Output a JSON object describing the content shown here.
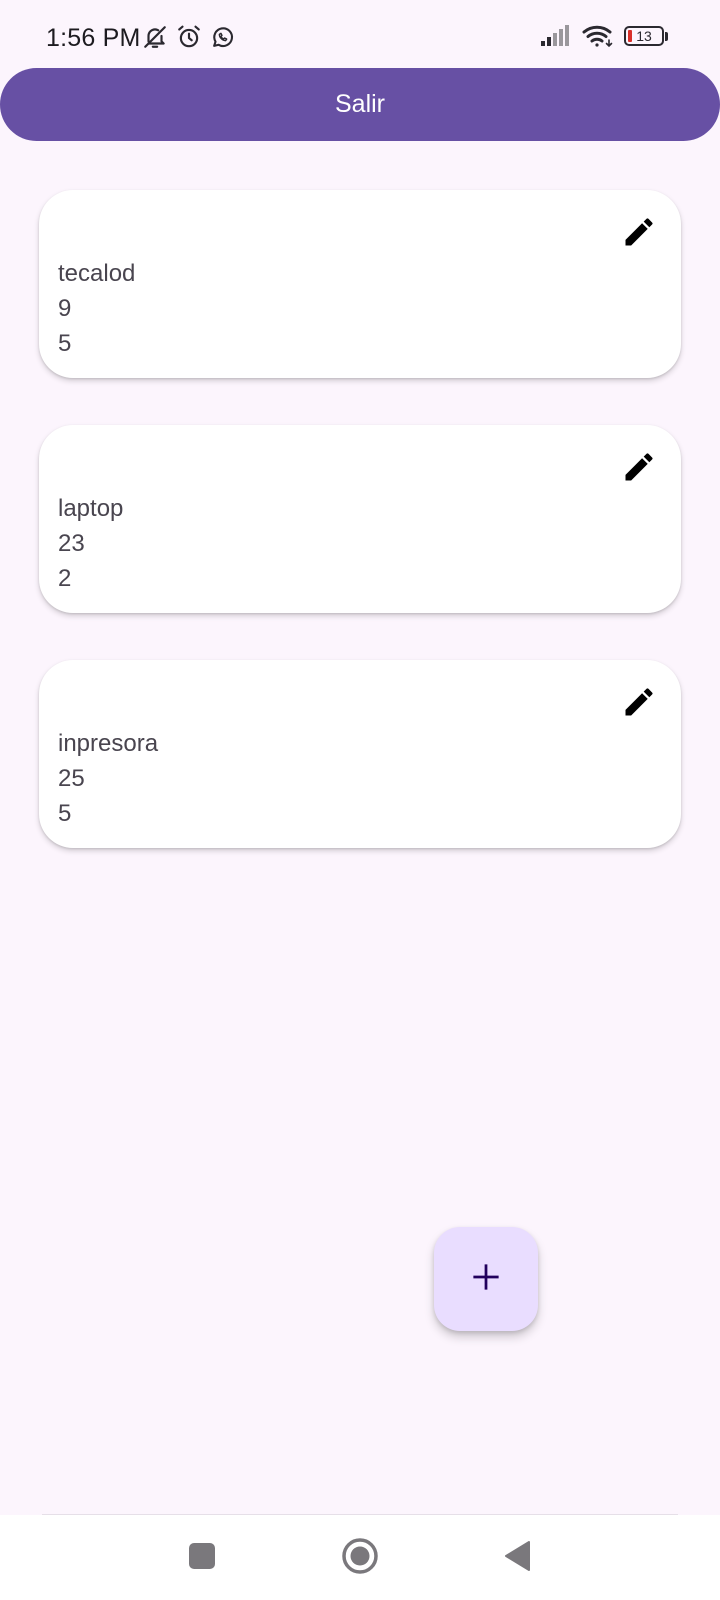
{
  "status_bar": {
    "time": "1:56 PM",
    "battery_level": "13",
    "icons_left": [
      "bell-off-icon",
      "alarm-icon",
      "whatsapp-icon"
    ],
    "icons_right": [
      "signal-icon",
      "wifi-icon",
      "battery-icon"
    ]
  },
  "header": {
    "exit_label": "Salir"
  },
  "items": [
    {
      "name": "tecalod",
      "value1": "9",
      "value2": "5"
    },
    {
      "name": "laptop",
      "value1": "23",
      "value2": "2"
    },
    {
      "name": "inpresora",
      "value1": "25",
      "value2": "5"
    }
  ],
  "fab": {
    "icon": "plus-icon"
  },
  "nav": {
    "buttons": [
      "recents-icon",
      "home-icon",
      "back-icon"
    ]
  },
  "colors": {
    "primary": "#6750a4",
    "background": "#fcf5fd",
    "fab_container": "#e9ddff",
    "card": "#ffffff",
    "card_text": "#49454f",
    "battery_low": "#d9302a"
  }
}
